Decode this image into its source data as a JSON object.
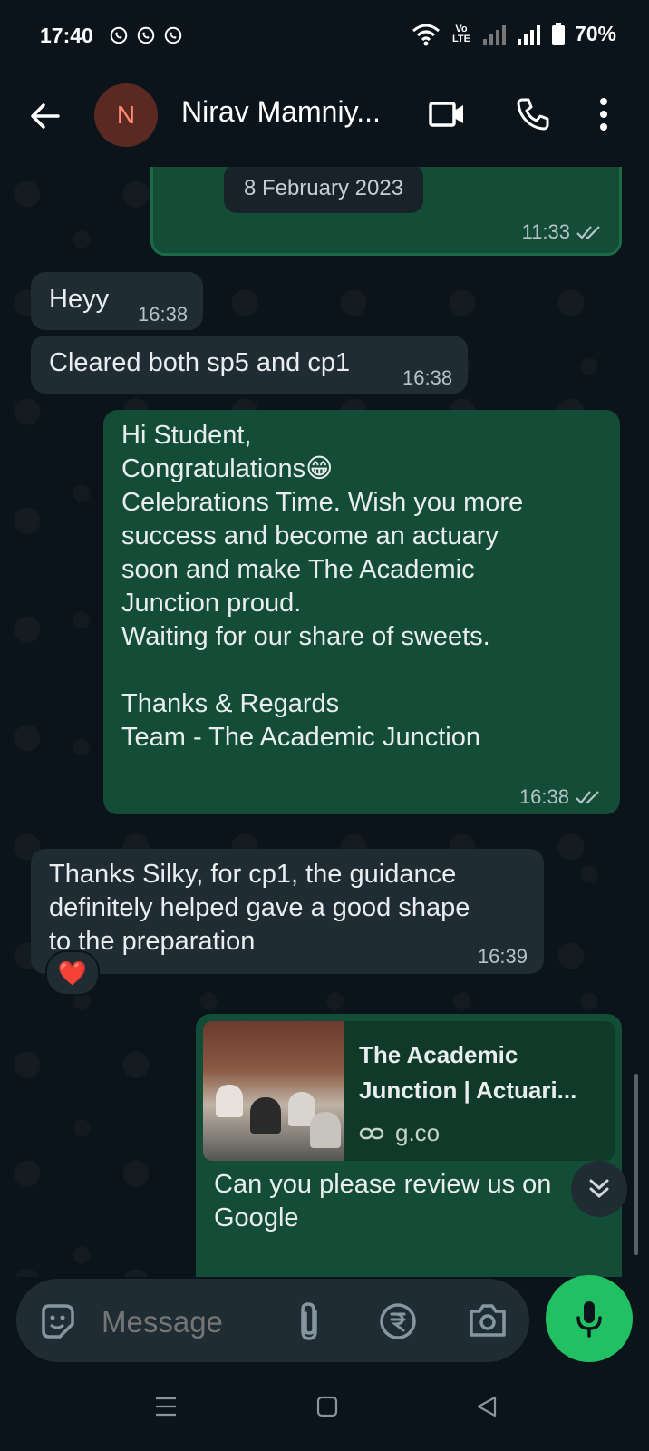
{
  "status_bar": {
    "time": "17:40",
    "network_label": "Vo LTE",
    "battery": "70%"
  },
  "header": {
    "avatar_initial": "N",
    "contact_name": "Nirav Mamniy..."
  },
  "messages": {
    "top_date_chip": "8 February 2023",
    "top_out_time": "11:33",
    "m1": {
      "text": "Heyy",
      "time": "16:38"
    },
    "m2": {
      "text": "Cleared both sp5 and cp1",
      "time": "16:38"
    },
    "m3": {
      "text": "Hi Student,\nCongratulations😁\nCelebrations Time. Wish you more\nsuccess and become an actuary\nsoon and make The Academic\nJunction proud.\nWaiting for our share of sweets.\n\nThanks & Regards\nTeam - The Academic Junction",
      "time": "16:38"
    },
    "m4": {
      "text": "Thanks Silky, for cp1, the guidance\ndefinitely helped gave a good shape\nto the preparation",
      "time": "16:39",
      "reaction": "❤️"
    },
    "m5": {
      "link_title": "The Academic\nJunction | Actuari...",
      "link_domain": "g.co",
      "text": "Can you please review us on\nGoogle"
    }
  },
  "composer": {
    "placeholder": "Message"
  },
  "colors": {
    "background": "#0b141a",
    "incoming_bubble": "#202c33",
    "outgoing_bubble": "#144d37",
    "mic_button": "#21c063"
  }
}
